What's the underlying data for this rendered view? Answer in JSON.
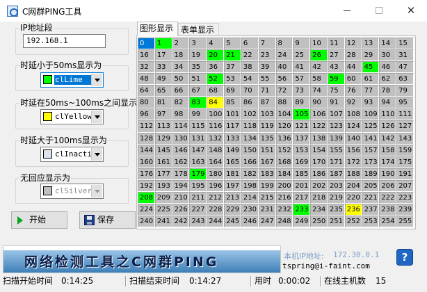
{
  "window": {
    "title": "C网群PING工具"
  },
  "ip_group": {
    "caption": "IP地址段",
    "value": "192.168.1"
  },
  "rules": [
    {
      "caption": "时延小于50ms显示为",
      "color_name": "clLime",
      "swatch": "#00ff00",
      "state": "focused"
    },
    {
      "caption": "时延在50ms~100ms之间显示为",
      "color_name": "clYellow",
      "swatch": "#ffff00",
      "state": "normal"
    },
    {
      "caption": "时延大于100ms显示为",
      "color_name": "clInactiv",
      "swatch": "#dbe3ef",
      "state": "normal"
    },
    {
      "caption": "无回应显示为",
      "color_name": "clSilver",
      "swatch": "#c0c0c0",
      "state": "disabled"
    }
  ],
  "buttons": {
    "start": "开始",
    "save": "保存"
  },
  "tabs": [
    {
      "label": "图形显示",
      "active": true
    },
    {
      "label": "表单显示",
      "active": false
    }
  ],
  "grid": {
    "selected": [
      0
    ],
    "lime": [
      1,
      20,
      21,
      26,
      45,
      52,
      59,
      83,
      105,
      179,
      208,
      233
    ],
    "yellow": [
      84,
      236
    ],
    "colors": {
      "lime": "#00ff00",
      "yellow": "#ffff00",
      "silver": "#c0c0c0",
      "selected": "#0078d7"
    }
  },
  "banner": {
    "text": "网络检测工具之C网群PING"
  },
  "footer": {
    "local_ip_label": "本机IP地址:",
    "local_ip_value": "172.30.0.1",
    "email": "tspring@i-faint.com",
    "help_icon": "?"
  },
  "status": {
    "scan_start_label": "扫描开始时间",
    "scan_start_value": "0:14:25",
    "scan_end_label": "扫描结束时间",
    "scan_end_value": "0:14:27",
    "elapsed_label": "用时",
    "elapsed_value": "0:00:02",
    "online_label": "在线主机数",
    "online_value": "15"
  }
}
